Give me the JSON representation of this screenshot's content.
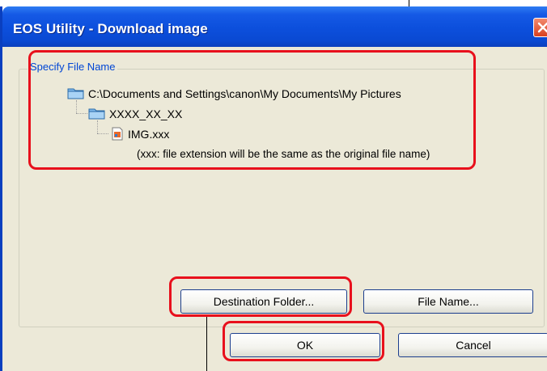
{
  "window": {
    "title": "EOS Utility - Download image"
  },
  "group": {
    "legend": "Specify File Name"
  },
  "tree": {
    "root": "C:\\Documents and Settings\\canon\\My Documents\\My Pictures",
    "folder": "XXXX_XX_XX",
    "file": "IMG.xxx",
    "note": "(xxx: file extension will be the same as the original file name)"
  },
  "buttons": {
    "destination": "Destination Folder...",
    "filename": "File Name...",
    "ok": "OK",
    "cancel": "Cancel"
  },
  "colors": {
    "highlight": "#e8101c",
    "title_bar": "#0c4fdc",
    "legend": "#0046d5"
  },
  "icons": [
    "close-icon",
    "folder-icon",
    "image-file-icon"
  ]
}
